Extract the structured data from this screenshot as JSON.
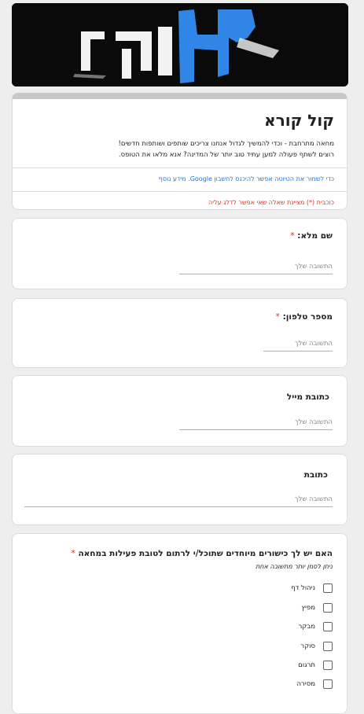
{
  "banner": {
    "logo_text": "אין קול"
  },
  "form": {
    "title": "קול קורא",
    "description_line1": "מחאה מתרחבת - וכדי להמשיך לגדול אנחנו צריכים שותפים ושותפות חדשים!",
    "description_line2": "רוצים לשתף פעולה למען עתיד טוב יותר של המדינה? אנא מלאו את הטופס.",
    "signin_note": "כדי לשמור את הטיוטה אפשר להיכנס לחשבון Google.",
    "learn_more": "מידע נוסף",
    "required_note": "כוכבית (*) מציינת שאלה שאי אפשר לדלג עליה"
  },
  "questions": [
    {
      "label": "שם מלא:",
      "required": "*",
      "placeholder": "התשובה שלך"
    },
    {
      "label": "מספר טלפון:",
      "required": "*",
      "placeholder": "התשובה שלך"
    },
    {
      "label": "כתובת מייל",
      "placeholder": "התשובה שלך"
    },
    {
      "label": "כתובת",
      "placeholder": "התשובה שלך"
    }
  ],
  "skills_question": {
    "label": "האם יש לך כישורים מיוחדים שתוכל/י לרתום לטובת פעילות במחאה",
    "required": "*",
    "note": "ניתן לסמן יותר מתשובה אחת",
    "options": [
      "ניהול דף",
      "מפיץ",
      "מבקר",
      "סוקר",
      "תרגום",
      "מסירה"
    ]
  },
  "colors": {
    "accent_required": "#d93025",
    "link": "#1a73e8",
    "banner_blue": "#2f86e6"
  }
}
